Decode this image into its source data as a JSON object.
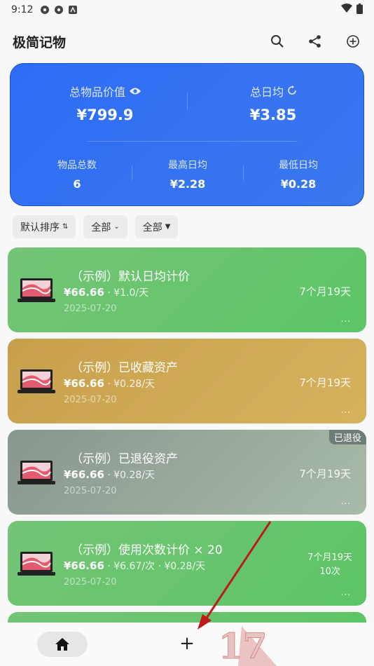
{
  "status": {
    "time": "9:12"
  },
  "appbar": {
    "title": "极简记物",
    "icons": [
      "search-icon",
      "share-icon",
      "add-circle-icon"
    ]
  },
  "summary": {
    "total_value_label": "总物品价值",
    "total_value": "¥799.9",
    "daily_avg_label": "总日均",
    "daily_avg": "¥3.85",
    "count_label": "物品总数",
    "count": "6",
    "max_daily_label": "最高日均",
    "max_daily": "¥2.28",
    "min_daily_label": "最低日均",
    "min_daily": "¥0.28",
    "bg_color": "#2e6cf5"
  },
  "filters": {
    "sort": "默认排序",
    "scope": "全部",
    "filter": "全部"
  },
  "items": [
    {
      "name": "（示例）默认日均计价",
      "price": "¥66.66",
      "rate": " · ¥1.0/天",
      "date": "2025-07-20",
      "duration": "7个月19天",
      "more": "...",
      "color": "#5cc565"
    },
    {
      "name": "（示例）已收藏资产",
      "price": "¥66.66",
      "rate": " · ¥0.28/天",
      "date": "2025-07-20",
      "duration": "7个月19天",
      "more": "...",
      "color": "#d6b25d"
    },
    {
      "name": "（示例）已退役资产",
      "price": "¥66.66",
      "rate": " · ¥0.28/天",
      "date": "2025-07-20",
      "duration": "7个月19天",
      "more": "...",
      "badge": "已退役",
      "color": "#9aab9c"
    },
    {
      "name": "（示例）使用次数计价 × 20",
      "price": "¥66.66",
      "rate": " · ¥6.67/次 · ¥0.28/天",
      "date": "2025-07-20",
      "duration": "7个月19天",
      "uses": "10次",
      "more": "...",
      "color": "#5cc565"
    }
  ],
  "bottom_nav": {
    "add": "+"
  },
  "watermark": "17"
}
